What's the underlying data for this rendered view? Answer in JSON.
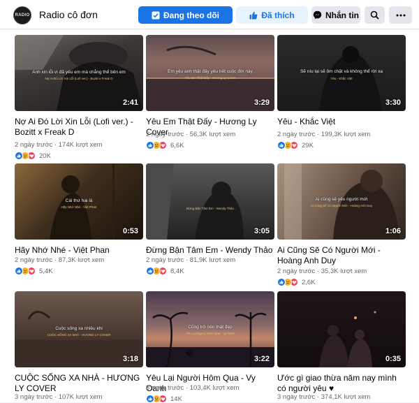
{
  "header": {
    "avatar_text": "RADIO",
    "page_name": "Radio cô đơn",
    "follow_label": "Đang theo dõi",
    "like_label": "Đã thích",
    "message_label": "Nhắn tin",
    "accent_color": "#1b74e4"
  },
  "videos": [
    {
      "title": "Nợ Ai Đó Lời Xin Lỗi (Lofi ver.) - Bozitt x Freak D",
      "time": "2 ngày trước",
      "views": "174K lượt xem",
      "reactions": "20K",
      "duration": "2:41",
      "caption": "Anh xin lỗi vì đã yêu em mà chẳng thể bên em",
      "subcaption": "Nợ Ai Đó Lời Xin Lỗi (Lofi ver.) - Bozitt x Freak D"
    },
    {
      "title": "Yêu Em Thật Đấy - Hương Ly Cover",
      "time": "2 ngày trước",
      "views": "56,3K lượt xem",
      "reactions": "6,6K",
      "duration": "3:29",
      "caption": "Em yêu anh thật đấy yêu hết cuộc đời này",
      "subcaption": "Yêu Em Thật Đấy - Hương Ly Cover"
    },
    {
      "title": "Yêu - Khắc Việt",
      "time": "2 ngày trước",
      "views": "199,3K lượt xem",
      "reactions": "29K",
      "duration": "3:30",
      "caption": "Sẽ níu lại sẽ ôm chặt và không thể rời xa",
      "subcaption": "Yêu - Khắc Việt"
    },
    {
      "title": "Hãy Nhớ Nhé - Việt Phan",
      "time": "2 ngày trước",
      "views": "87,3K lượt xem",
      "reactions": "5,4K",
      "duration": "0:53",
      "caption": "Cái thứ hai là",
      "subcaption": "Hãy Nhớ Nhé - Việt Phan"
    },
    {
      "title": "Đừng Bận Tâm Em - Wendy Thảo",
      "time": "2 ngày trước",
      "views": "81,9K lượt xem",
      "reactions": "8,4K",
      "duration": "3:05",
      "caption": "",
      "subcaption": "Đừng Bận Tâm Em - Wendy Thảo"
    },
    {
      "title": "Ai Cũng Sẽ Có Người Mới - Hoàng Anh Duy",
      "time": "2 ngày trước",
      "views": "35,3K lượt xem",
      "reactions": "2,6K",
      "duration": "1:06",
      "caption": "Ai cũng sẽ yêu người mới",
      "subcaption": "Ai Cũng Sẽ Có Người Mới - Hoàng Anh Duy"
    },
    {
      "title": "CUỘC SỐNG XA NHÀ - HƯƠNG LY COVER",
      "time": "3 ngày trước",
      "views": "107K lượt xem",
      "reactions": "",
      "duration": "3:18",
      "caption": "Cuộc sống xa nhiều khi",
      "subcaption": "CUỘC SỐNG XA NHÀ - HƯƠNG LY COVER"
    },
    {
      "title": "Yêu Lại Người Hôm Qua - Vy Oanh",
      "time": "3 ngày trước",
      "views": "103,4K lượt xem",
      "reactions": "14K",
      "duration": "3:22",
      "caption": "Cũng trở nên thật đẹp",
      "subcaption": "Yêu Lại Người Hôm Qua - Vy Oanh"
    },
    {
      "title": "Ước gì giao thừa năm nay mình có người yêu ♥",
      "time": "3 ngày trước",
      "views": "374,1K lượt xem",
      "reactions": "",
      "duration": "0:35",
      "caption": "",
      "subcaption": ""
    }
  ]
}
